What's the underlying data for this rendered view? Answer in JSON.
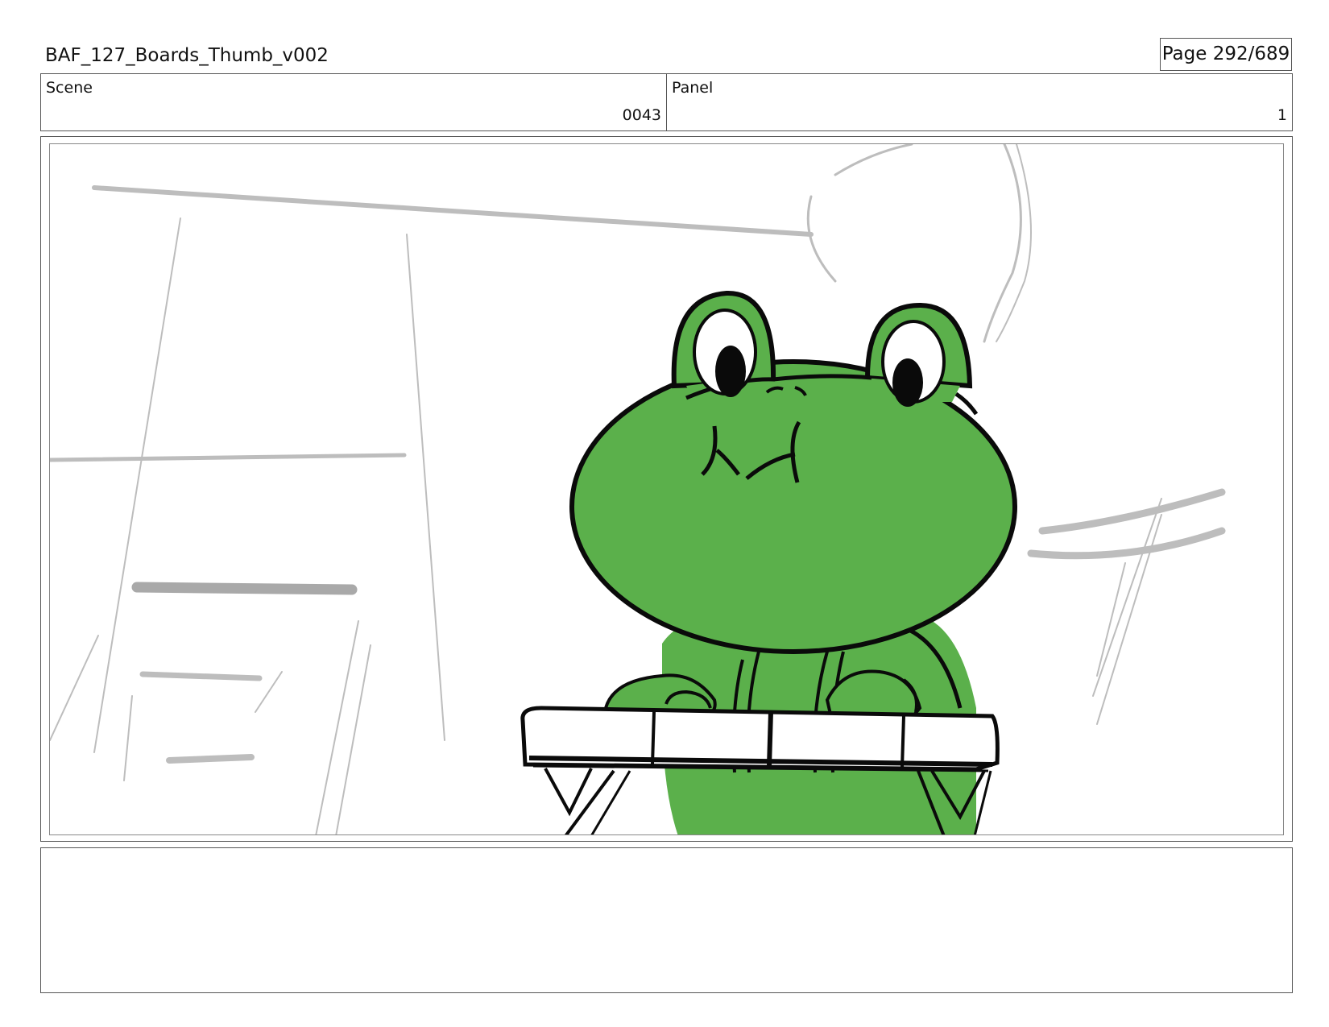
{
  "header": {
    "title": "BAF_127_Boards_Thumb_v002",
    "page": "Page 292/689"
  },
  "scene": {
    "label": "Scene",
    "value": "0043"
  },
  "panel": {
    "label": "Panel",
    "value": "1"
  },
  "colors": {
    "frog_green": "#5BB04B",
    "line_black": "#0a0a0a",
    "sketch_grey": "#b9b9b9"
  },
  "notes": {
    "text": ""
  }
}
